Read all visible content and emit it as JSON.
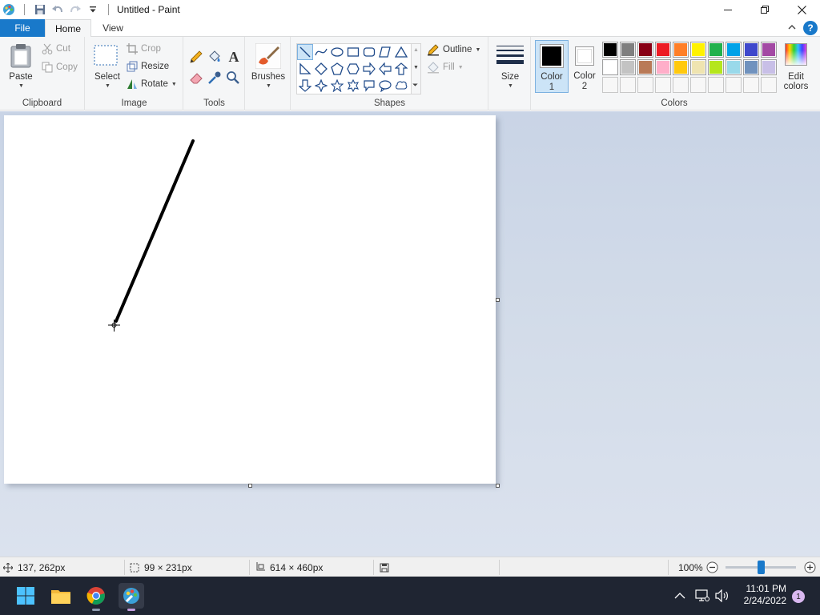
{
  "window": {
    "title": "Untitled - Paint"
  },
  "menu": {
    "file": "File",
    "home": "Home",
    "view": "View",
    "help": "?"
  },
  "clipboard": {
    "paste": "Paste",
    "cut": "Cut",
    "copy": "Copy",
    "label": "Clipboard"
  },
  "image": {
    "select": "Select",
    "crop": "Crop",
    "resize": "Resize",
    "rotate": "Rotate",
    "label": "Image"
  },
  "tools": {
    "label": "Tools"
  },
  "brushes": {
    "label": "Brushes"
  },
  "shapes": {
    "outline": "Outline",
    "fill": "Fill",
    "label": "Shapes"
  },
  "size": {
    "label": "Size"
  },
  "colors": {
    "color1_line1": "Color",
    "color1_line2": "1",
    "color2_line1": "Color",
    "color2_line2": "2",
    "edit_line1": "Edit",
    "edit_line2": "colors",
    "label": "Colors",
    "color1_value": "#000000",
    "color2_value": "#ffffff",
    "palette_row1": [
      "#000000",
      "#7f7f7f",
      "#880015",
      "#ed1c24",
      "#ff7f27",
      "#fff200",
      "#22b14c",
      "#00a2e8",
      "#3f48cc",
      "#a349a4"
    ],
    "palette_row2": [
      "#ffffff",
      "#c3c3c3",
      "#b97a57",
      "#ffaec9",
      "#ffc90e",
      "#efe4b0",
      "#b5e61d",
      "#99d9ea",
      "#7092be",
      "#c8bfe7"
    ]
  },
  "status": {
    "cursor_pos": "137, 262px",
    "selection_size": "99 × 231px",
    "canvas_size": "614 × 460px",
    "zoom": "100%"
  },
  "taskbar": {
    "time": "11:01 PM",
    "date": "2/24/2022",
    "notifications": "1"
  }
}
